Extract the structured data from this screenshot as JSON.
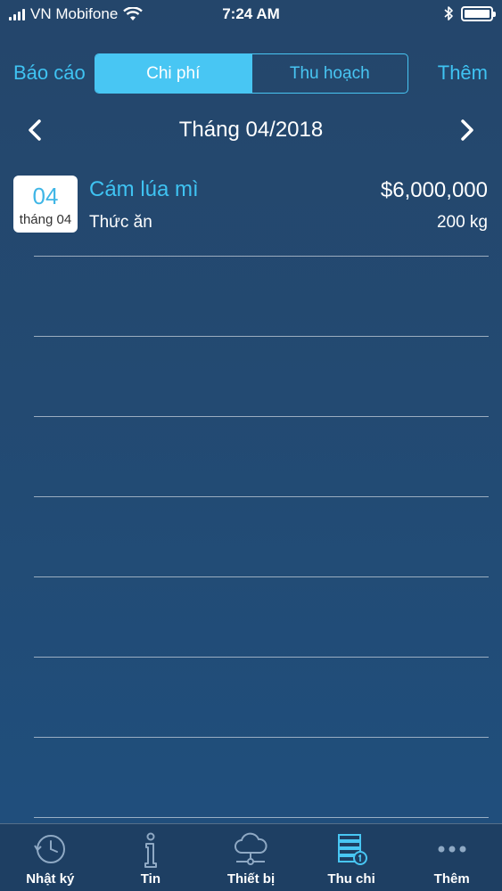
{
  "status_bar": {
    "carrier": "VN Mobifone",
    "time": "7:24 AM",
    "battery_percent": 100
  },
  "nav": {
    "left_label": "Báo cáo",
    "right_label": "Thêm",
    "segments": [
      "Chi phí",
      "Thu hoạch"
    ],
    "selected_segment": "Chi phí"
  },
  "month": {
    "title": "Tháng 04/2018"
  },
  "entries": [
    {
      "day": "04",
      "month_label": "tháng 04",
      "title": "Cám lúa mì",
      "amount": "$6,000,000",
      "category": "Thức ăn",
      "quantity": "200 kg"
    }
  ],
  "tabs": [
    {
      "label": "Nhật ký",
      "icon": "clock-icon"
    },
    {
      "label": "Tin",
      "icon": "info-icon"
    },
    {
      "label": "Thiết bị",
      "icon": "cloud-network-icon"
    },
    {
      "label": "Thu chi",
      "icon": "money-stack-icon"
    },
    {
      "label": "Thêm",
      "icon": "more-dots-icon"
    }
  ],
  "active_tab": "Thu chi",
  "colors": {
    "accent": "#3fc3f2",
    "background_top": "#24466b",
    "background_bottom": "#1f4f7e",
    "tabbar": "#1e3f63"
  }
}
